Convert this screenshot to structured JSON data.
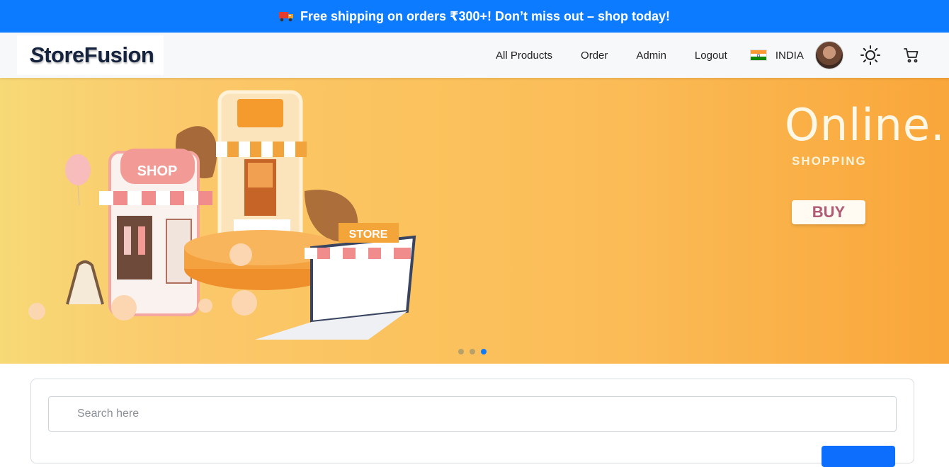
{
  "announcement": {
    "text": "Free shipping on orders ₹300+! Don’t miss out – shop today!",
    "icon": "truck-icon"
  },
  "header": {
    "logo_first": "S",
    "logo_rest": "toreFusion",
    "nav": [
      {
        "label": "All Products"
      },
      {
        "label": "Order"
      },
      {
        "label": "Admin"
      },
      {
        "label": "Logout"
      }
    ],
    "country": "INDIA",
    "icons": [
      "india-flag-icon",
      "avatar",
      "sun-icon",
      "cart-icon"
    ]
  },
  "banner": {
    "headline": "Online.",
    "subheadline": "SHOPPING",
    "button_label": "BUY",
    "illustration_labels": {
      "shop_sign": "SHOP",
      "store_sign": "STORE"
    },
    "carousel": {
      "slides": 3,
      "active_index": 2
    }
  },
  "search": {
    "placeholder": "Search here",
    "value": ""
  },
  "colors": {
    "primary": "#0d7bff",
    "banner_start": "#f7d976",
    "banner_end": "#f9a63a"
  }
}
